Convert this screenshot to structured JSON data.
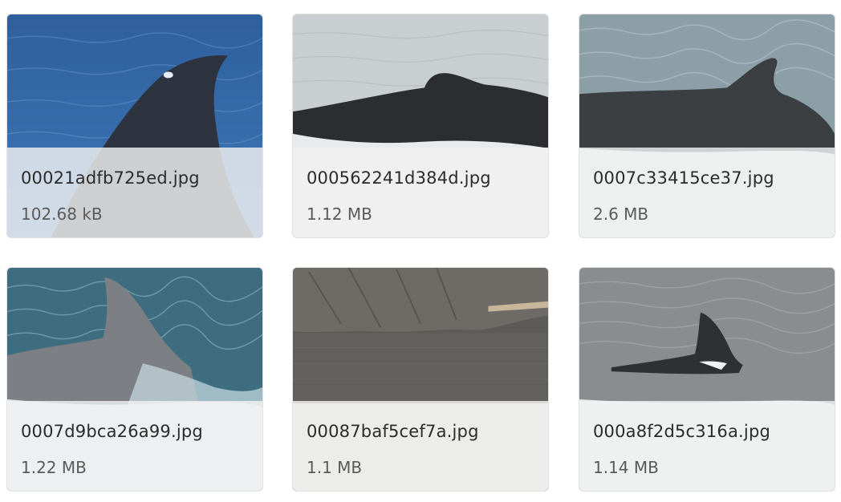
{
  "gallery": {
    "items": [
      {
        "filename": "00021adfb725ed.jpg",
        "size": "102.68 kB",
        "thumbnail": "whale-fin-blue-water"
      },
      {
        "filename": "000562241d384d.jpg",
        "size": "1.12 MB",
        "thumbnail": "whale-back-grey-water"
      },
      {
        "filename": "0007c33415ce37.jpg",
        "size": "2.6 MB",
        "thumbnail": "whale-fin-choppy-water"
      },
      {
        "filename": "0007d9bca26a99.jpg",
        "size": "1.22 MB",
        "thumbnail": "dolphin-fin-splash"
      },
      {
        "filename": "00087baf5cef7a.jpg",
        "size": "1.1 MB",
        "thumbnail": "rocky-shore-calm-water"
      },
      {
        "filename": "000a8f2d5c316a.jpg",
        "size": "1.14 MB",
        "thumbnail": "orca-fin-grey-water"
      }
    ]
  }
}
